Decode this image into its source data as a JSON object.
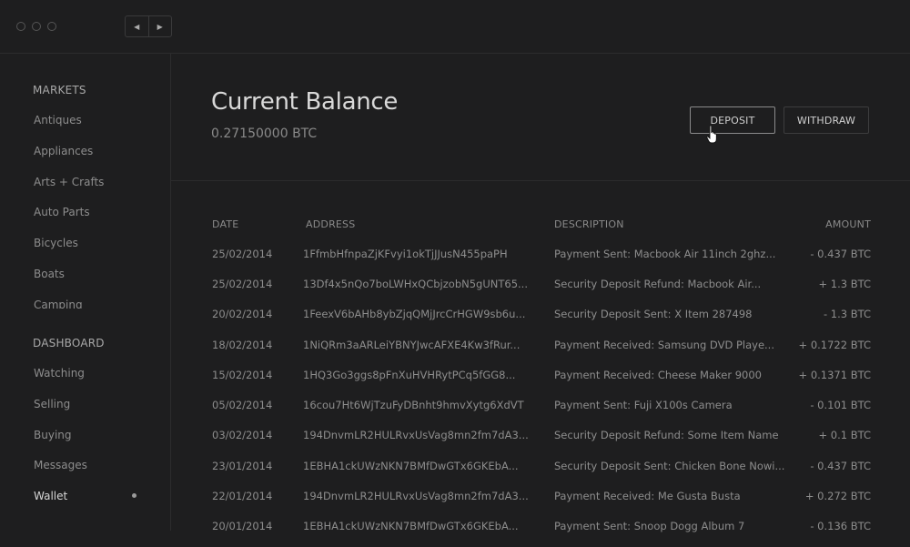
{
  "window": {
    "nav_back": "◀",
    "nav_forward": "▶"
  },
  "sidebar": {
    "markets_heading": "MARKETS",
    "markets": [
      "Antiques",
      "Appliances",
      "Arts + Crafts",
      "Auto Parts",
      "Bicycles",
      "Boats",
      "Camping"
    ],
    "dashboard_heading": "DASHBOARD",
    "dashboard": [
      "Watching",
      "Selling",
      "Buying",
      "Messages",
      "Wallet"
    ],
    "active_item": "Wallet"
  },
  "balance": {
    "title": "Current Balance",
    "value": "0.27150000 BTC",
    "deposit_label": "DEPOSIT",
    "withdraw_label": "WITHDRAW"
  },
  "table": {
    "headers": {
      "date": "DATE",
      "address": "ADDRESS",
      "description": "DESCRIPTION",
      "amount": "AMOUNT"
    },
    "rows": [
      {
        "date": "25/02/2014",
        "address": "1FfmbHfnpaZjKFvyi1okTjJJusN455paPH",
        "description": "Payment Sent: Macbook Air 11inch 2ghz...",
        "amount": "- 0.437 BTC"
      },
      {
        "date": "25/02/2014",
        "address": "13Df4x5nQo7boLWHxQCbjzobN5gUNT65...",
        "description": "Security Deposit Refund: Macbook Air...",
        "amount": "+ 1.3 BTC"
      },
      {
        "date": "20/02/2014",
        "address": "1FeexV6bAHb8ybZjqQMjJrcCrHGW9sb6u...",
        "description": "Security Deposit Sent: X Item 287498",
        "amount": "- 1.3 BTC"
      },
      {
        "date": "18/02/2014",
        "address": "1NiQRm3aARLeiYBNYJwcAFXE4Kw3fRur...",
        "description": "Payment Received: Samsung DVD Playe...",
        "amount": "+ 0.1722 BTC"
      },
      {
        "date": "15/02/2014",
        "address": "1HQ3Go3ggs8pFnXuHVHRytPCq5fGG8...",
        "description": "Payment Received: Cheese Maker 9000",
        "amount": "+ 0.1371 BTC"
      },
      {
        "date": "05/02/2014",
        "address": "16cou7Ht6WjTzuFyDBnht9hmvXytg6XdVT",
        "description": "Payment Sent: Fuji X100s Camera",
        "amount": "- 0.101 BTC"
      },
      {
        "date": "03/02/2014",
        "address": "194DnvmLR2HULRvxUsVag8mn2fm7dA3...",
        "description": "Security Deposit Refund: Some Item Name",
        "amount": "+ 0.1 BTC"
      },
      {
        "date": "23/01/2014",
        "address": "1EBHA1ckUWzNKN7BMfDwGTx6GKEbA...",
        "description": "Security Deposit Sent: Chicken Bone Nowi...",
        "amount": "- 0.437 BTC"
      },
      {
        "date": "22/01/2014",
        "address": "194DnvmLR2HULRvxUsVag8mn2fm7dA3...",
        "description": "Payment Received: Me Gusta Busta",
        "amount": "+ 0.272 BTC"
      },
      {
        "date": "20/01/2014",
        "address": "1EBHA1ckUWzNKN7BMfDwGTx6GKEbA...",
        "description": "Payment Sent: Snoop Dogg Album 7",
        "amount": "- 0.136 BTC"
      }
    ]
  }
}
